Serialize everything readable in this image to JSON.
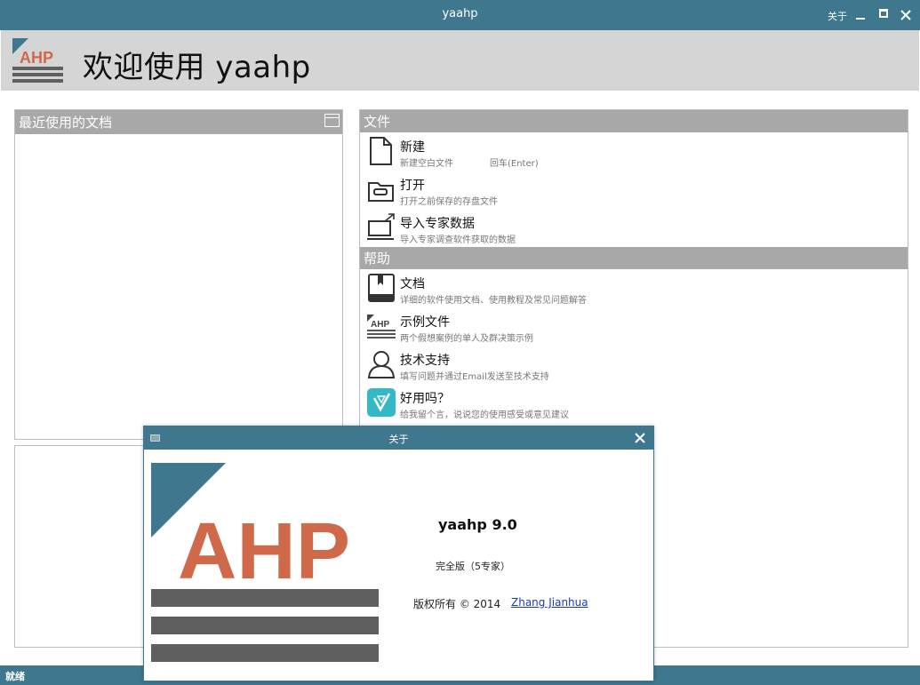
{
  "window": {
    "title": "yaahp",
    "about_link": "关于"
  },
  "header": {
    "logo_text": "AHP",
    "welcome": "欢迎使用 yaahp"
  },
  "recent_panel": {
    "title": "最近使用的文档"
  },
  "file_section": {
    "title": "文件",
    "items": [
      {
        "title": "新建",
        "desc": "新建空白文件",
        "shortcut": "回车(Enter)",
        "icon": "new-file-icon"
      },
      {
        "title": "打开",
        "desc": "打开之前保存的存盘文件",
        "icon": "open-folder-icon"
      },
      {
        "title": "导入专家数据",
        "desc": "导入专家调查软件获取的数据",
        "icon": "import-data-icon"
      }
    ]
  },
  "help_section": {
    "title": "帮助",
    "items": [
      {
        "title": "文档",
        "desc": "详细的软件使用文档、使用教程及常见问题解答",
        "icon": "book-icon"
      },
      {
        "title": "示例文件",
        "desc": "两个假想案例的单人及群决策示例",
        "icon": "ahp-logo-icon"
      },
      {
        "title": "技术支持",
        "desc": "填写问题并通过Email发送至技术支持",
        "icon": "user-icon"
      },
      {
        "title": "好用吗？",
        "desc": "给我留个言，说说您的使用感受或意见建议",
        "icon": "feedback-icon"
      }
    ]
  },
  "statusbar": {
    "text": "就绪"
  },
  "about_dialog": {
    "title": "关于",
    "logo_text": "AHP",
    "version": "yaahp 9.0",
    "edition": "完全版（5专家）",
    "copyright": "版权所有 © 2014",
    "author": "Zhang Jianhua"
  },
  "colors": {
    "titlebar": "#3f788e",
    "logo_orange": "#d0694a",
    "logo_bars": "#5f5f5f",
    "section_gray": "#a8a8a8"
  }
}
